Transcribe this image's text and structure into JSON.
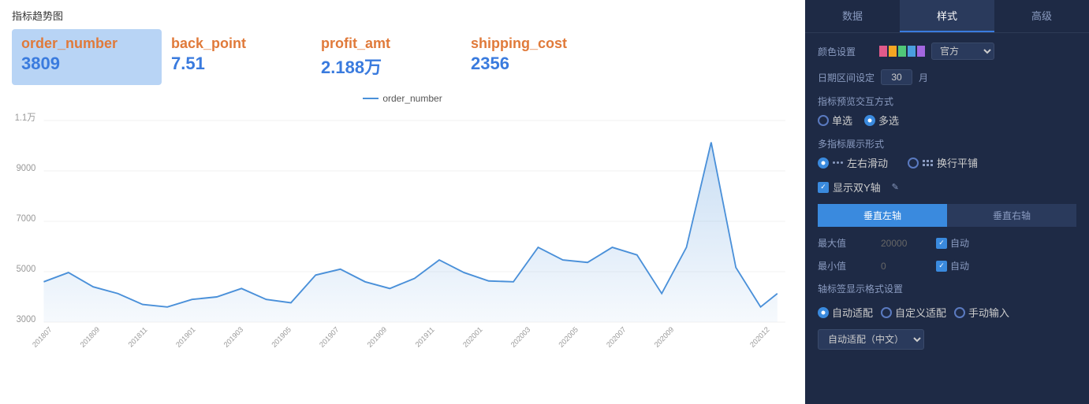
{
  "chart": {
    "title": "指标趋势图",
    "legend": "order_number",
    "metrics": [
      {
        "id": "order_number",
        "name": "order_number",
        "value": "3809",
        "active": true
      },
      {
        "id": "back_point",
        "name": "back_point",
        "value": "7.51",
        "active": false
      },
      {
        "id": "profit_amt",
        "name": "profit_amt",
        "value": "2.188万",
        "active": false
      },
      {
        "id": "shipping_cost",
        "name": "shipping_cost",
        "value": "2356",
        "active": false
      }
    ],
    "yAxis": {
      "labels": [
        "1.1万",
        "9000",
        "7000",
        "5000",
        "3000"
      ],
      "values": [
        11000,
        9000,
        7000,
        5000,
        3000
      ]
    },
    "xAxis": {
      "labels": [
        "201807",
        "201809",
        "201811",
        "201901",
        "201903",
        "201905",
        "201907",
        "201909",
        "201911",
        "202001",
        "202003",
        "202005",
        "202007",
        "202009",
        "202012"
      ]
    },
    "dataPoints": [
      4700,
      5100,
      4500,
      4200,
      3800,
      3700,
      4000,
      4100,
      4400,
      4000,
      3900,
      5000,
      5200,
      4700,
      4400,
      4900,
      5600,
      5100,
      4800,
      4700,
      6100,
      5600,
      5500,
      6100,
      5800,
      4200,
      6100,
      10800,
      5300,
      3700,
      4200
    ]
  },
  "settings": {
    "tabs": [
      "数据",
      "样式",
      "高级"
    ],
    "active_tab": "样式",
    "color_label": "颜色设置",
    "color_preset": "官方",
    "color_swatches": [
      "#e05a8a",
      "#f5a623",
      "#50c878",
      "#4a9ede",
      "#a367e0"
    ],
    "date_range_label": "日期区间设定",
    "date_range_value": "30",
    "date_range_unit": "月",
    "interaction_label": "指标预览交互方式",
    "interaction_options": [
      "单选",
      "多选"
    ],
    "interaction_selected": "多选",
    "multi_display_label": "多指标展示形式",
    "display_options": [
      {
        "id": "scroll",
        "label": "左右滑动",
        "selected": true
      },
      {
        "id": "wrap",
        "label": "换行平铺",
        "selected": false
      }
    ],
    "dual_yaxis_label": "显示双Y轴",
    "dual_yaxis_checked": true,
    "edit_icon": "✎",
    "axis_buttons": [
      {
        "label": "垂直左轴",
        "active": true
      },
      {
        "label": "垂直右轴",
        "active": false
      }
    ],
    "max_label": "最大值",
    "max_value": "20000",
    "max_auto_label": "自动",
    "max_auto_checked": true,
    "min_label": "最小值",
    "min_value": "0",
    "min_auto_label": "自动",
    "min_auto_checked": true,
    "format_label": "轴标签显示格式设置",
    "format_options": [
      "自动适配",
      "自定义适配",
      "手动输入"
    ],
    "format_selected": "自动适配",
    "adapt_dropdown": "自动适配（中文）",
    "chevron_icon": "▾"
  }
}
